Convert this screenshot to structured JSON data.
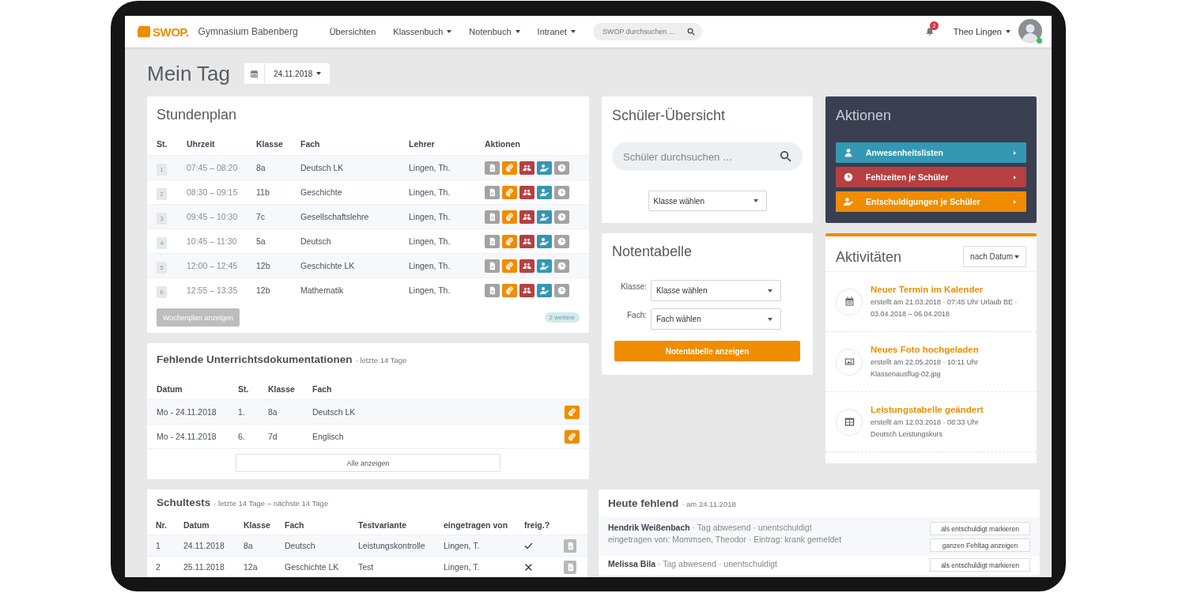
{
  "nav": {
    "logo": "SWOP.",
    "school": "Gymnasium Babenberg",
    "menu": [
      {
        "label": "Übersichten",
        "dropdown": false
      },
      {
        "label": "Klassenbuch",
        "dropdown": true
      },
      {
        "label": "Notenbuch",
        "dropdown": true
      },
      {
        "label": "Intranet",
        "dropdown": true
      }
    ],
    "search": {
      "placeholder": "SWOP durchsuchen ..."
    },
    "notifications": "2",
    "user": "Theo Lingen",
    "online": true
  },
  "page": {
    "title": "Mein Tag",
    "date": "24.11.2018"
  },
  "stundenplan": {
    "title": "Stundenplan",
    "columns": [
      "St.",
      "Uhrzeit",
      "Klasse",
      "Fach",
      "Lehrer",
      "Aktionen"
    ],
    "rows": [
      {
        "st": "1",
        "time": "07:45 – 08:20",
        "klasse": "8a",
        "fach": "Deutsch LK",
        "lehrer": "Lingen, Th."
      },
      {
        "st": "2",
        "time": "08:30 – 09:15",
        "klasse": "11b",
        "fach": "Geschichte",
        "lehrer": "Lingen, Th."
      },
      {
        "st": "3",
        "time": "09:45 – 10:30",
        "klasse": "7c",
        "fach": "Gesellschaftslehre",
        "lehrer": "Lingen, Th."
      },
      {
        "st": "4",
        "time": "10:45 – 11:30",
        "klasse": "5a",
        "fach": "Deutsch",
        "lehrer": "Lingen, Th."
      },
      {
        "st": "5",
        "time": "12:00 – 12:45",
        "klasse": "12b",
        "fach": "Geschichte LK",
        "lehrer": "Lingen, Th."
      },
      {
        "st": "6",
        "time": "12:55 – 13:35",
        "klasse": "12b",
        "fach": "Mathematik",
        "lehrer": "Lingen, Th."
      }
    ],
    "week_button": {
      "label": "Wochenplan anzeigen",
      "disabled": true
    },
    "more": "2 weitere"
  },
  "fehlende": {
    "title": "Fehlende Unterrichtsdokumentationen",
    "subtitle": "· letzte 14 Tage",
    "columns": [
      "Datum",
      "St.",
      "Klasse",
      "Fach"
    ],
    "rows": [
      {
        "datum": "Mo - 24.11.2018",
        "st": "1.",
        "klasse": "8a",
        "fach": "Deutsch LK"
      },
      {
        "datum": "Mo - 24.11.2018",
        "st": "6.",
        "klasse": "7d",
        "fach": "Englisch"
      }
    ],
    "button": "Alle anzeigen"
  },
  "schultests": {
    "title": "Schultests",
    "subtitle": "· letzte 14 Tage – nächste 14 Tage",
    "columns": [
      "Nr.",
      "Datum",
      "Klasse",
      "Fach",
      "Testvariante",
      "eingetragen von",
      "freig.?"
    ],
    "rows": [
      {
        "nr": "1",
        "datum": "24.11.2018",
        "klasse": "8a",
        "fach": "Deutsch",
        "variante": "Leistungskontrolle",
        "von": "Lingen, T.",
        "released": true
      },
      {
        "nr": "2",
        "datum": "25.11.2018",
        "klasse": "12a",
        "fach": "Geschichte LK",
        "variante": "Test",
        "von": "Lingen, T.",
        "released": false
      }
    ]
  },
  "schueler": {
    "title": "Schüler-Übersicht",
    "search": {
      "placeholder": "Schüler durchsuchen …"
    },
    "select": "Klasse wählen"
  },
  "notentabelle": {
    "title": "Notentabelle",
    "fields": [
      {
        "label": "Klasse:",
        "value": "Klasse wählen"
      },
      {
        "label": "Fach:",
        "value": "Fach wählen"
      }
    ],
    "button": "Notentabelle anzeigen"
  },
  "aktionen": {
    "title": "Aktionen",
    "items": [
      {
        "label": "Anwesenheitslisten",
        "color": "#3497b4",
        "kind": "user"
      },
      {
        "label": "Fehlzeiten je Schüler",
        "color": "#b73f41",
        "kind": "clock"
      },
      {
        "label": "Entschuldigungen je Schüler",
        "color": "#f08c00",
        "kind": "usercheck"
      }
    ]
  },
  "aktivitaeten": {
    "title": "Aktivitäten",
    "sort": "nach Datum",
    "items": [
      {
        "kind": "calendar",
        "title": "Neuer Termin im Kalender",
        "lines": [
          "erstellt am 21.03.2018 · 07:45 Uhr Urlaub BE ·",
          "03.04.2018 – 06.04.2018"
        ]
      },
      {
        "kind": "photo",
        "title": "Neues Foto hochgeladen",
        "lines": [
          "erstellt am 22.05.2018 · 10:11 Uhr",
          "Klassenausflug-02.jpg"
        ]
      },
      {
        "kind": "table",
        "title": "Leistungstabelle geändert",
        "lines": [
          "erstellt am 12.03.2018 · 08:33 Uhr",
          "Deutsch Leistungskurs"
        ]
      }
    ]
  },
  "heute_fehlend": {
    "title": "Heute fehlend",
    "subtitle": "· am 24.11.2018",
    "rows": [
      {
        "name": "Hendrik Weißenbach",
        "info": "· Tag abwesend · unentschuldigt",
        "detail": "eingetragen von: Mommsen, Theodor · Eintrag: krank gemeldet",
        "buttons": [
          "als entschuldigt markieren",
          "ganzen Fehltag anzeigen"
        ]
      },
      {
        "name": "Melissa Bila",
        "info": "· Tag abwesend · unentschuldigt",
        "buttons": [
          "als entschuldigt markieren"
        ]
      }
    ]
  }
}
